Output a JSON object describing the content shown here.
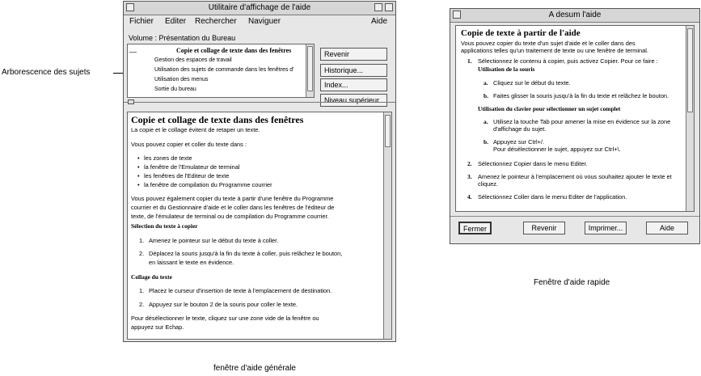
{
  "captions": {
    "tree": "Arborescence des sujets",
    "general": "fenêtre d'aide générale",
    "quick": "Fenêtre d'aide rapide"
  },
  "general_window": {
    "title": "Utilitaire d'affichage de l'aide",
    "menu": [
      "Fichier",
      "Editer",
      "Rechercher",
      "Naviguer"
    ],
    "menu_help": "Aide",
    "volume_label": "Volume : Présentation du Bureau",
    "topics": [
      "Copie et collage de texte dans des fenêtres",
      "Gestion des espaces de travail",
      "Utilisation des sujets de commande dans les fenêtres d'",
      "Utilisation des menus",
      "Sortie du bureau"
    ],
    "nav_buttons": [
      "Revenir",
      "Historique...",
      "Index...",
      "Niveau supérieur"
    ],
    "content": {
      "title": "Copie et collage de texte dans des fenêtres",
      "intro": "La copie et le collage évitent de retaper un texte.",
      "can_copy": "Vous pouvez copier et coller du texte dans :",
      "bullets": [
        "les zones de texte",
        "la fenêtre de l'Emulateur de terminal",
        "les fenêtres de l'Editeur de texte",
        "la fenêtre de compilation du Programme courrier"
      ],
      "para": [
        "Vous pouvez également copier du texte à partir d'une fenêtre du Programme",
        "courrier et du Gestionnaire d'aide et le coller dans les fenêtres de l'éditeur de",
        "texte, de l'émulateur de terminal ou de compilation du Programme courrier."
      ],
      "select_heading": "Sélection du texte à copier",
      "select_steps": [
        [
          "1.",
          "Amenez le pointeur sur le début du texte à coller."
        ],
        [
          "2.",
          "Déplacez la souris jusqu'à la fin du texte à coller, puis relâchez le bouton,",
          "en laissant le texte en évidence."
        ]
      ],
      "paste_heading": "Collage du texte",
      "paste_steps": [
        [
          "1.",
          "Placez le curseur d'insertion de texte à l'emplacement de destination."
        ],
        [
          "2.",
          "Appuyez sur le bouton 2 de la souris pour coller le texte."
        ]
      ],
      "footer": [
        "Pour désélectionner le texte, cliquez sur une zone vide de la fenêtre ou",
        "appuyez sur Echap."
      ]
    }
  },
  "quick_window": {
    "title": "A desum l'aide",
    "content": {
      "title": "Copie de texte à partir de l'aide",
      "intro": [
        "Vous pouvez copier du texte d'un sujet d'aide et le coller dans des",
        "applications telles qu'un traitement de texte ou une fenêtre de terminal."
      ],
      "step1": "Sélectionnez le contenu à copier, puis activez Copier. Pour ce faire :",
      "mouse_heading": "Utilisation de la souris",
      "mouse_items": [
        [
          "a.",
          "Cliquez sur le début du texte."
        ],
        [
          "b.",
          "Faites glisser la souris jusqu'à la fin du texte et relâchez le bouton."
        ]
      ],
      "kbd_heading": "Utilisation du clavier pour sélectionner un sujet complet",
      "kbd_items": [
        [
          "a.",
          "Utilisez la touche Tab pour amener la mise en évidence sur la zone",
          "d'affichage du sujet."
        ],
        [
          "b.",
          "Appuyez sur Ctrl+/.",
          "Pour désélectionner le sujet, appuyez sur Ctrl+\\."
        ]
      ],
      "steps": [
        [
          "2.",
          "Sélectionnez Copier dans le menu Editer."
        ],
        [
          "3.",
          "Amenez le pointeur à l'emplacement où vous souhaitez ajouter le texte et",
          "cliquez."
        ],
        [
          "4.",
          "Sélectionnez Coller dans le menu Editer de l'application."
        ]
      ]
    },
    "buttons": [
      "Fermer",
      "Revenir",
      "Imprimer...",
      "Aide"
    ]
  }
}
